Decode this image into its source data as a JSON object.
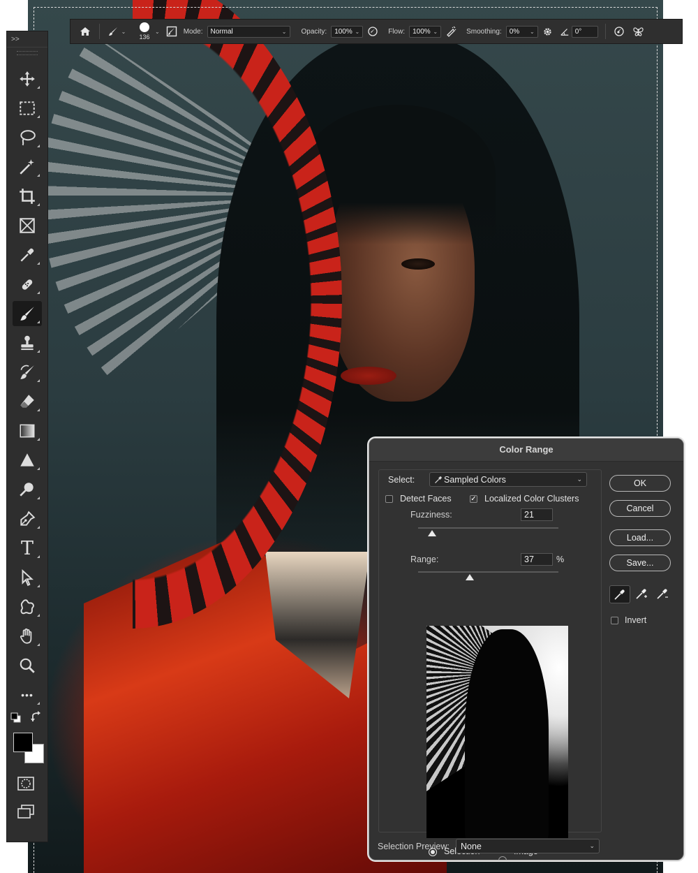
{
  "options_bar": {
    "brush_size": "136",
    "mode_label": "Mode:",
    "mode_value": "Normal",
    "opacity_label": "Opacity:",
    "opacity_value": "100%",
    "flow_label": "Flow:",
    "flow_value": "100%",
    "smoothing_label": "Smoothing:",
    "smoothing_value": "0%",
    "angle_value": "0°"
  },
  "toolbar": {
    "collapse_glyph": ">>",
    "tools": [
      {
        "name": "move-tool",
        "icon": "move-icon"
      },
      {
        "name": "rectangular-marquee-tool",
        "icon": "marquee-icon"
      },
      {
        "name": "lasso-tool",
        "icon": "lasso-icon"
      },
      {
        "name": "magic-wand-tool",
        "icon": "magic-wand-icon"
      },
      {
        "name": "crop-tool",
        "icon": "crop-icon"
      },
      {
        "name": "frame-tool",
        "icon": "frame-icon"
      },
      {
        "name": "eyedropper-tool",
        "icon": "eyedropper-icon"
      },
      {
        "name": "spot-healing-tool",
        "icon": "healing-icon"
      },
      {
        "name": "brush-tool",
        "icon": "brush-icon",
        "active": true
      },
      {
        "name": "clone-stamp-tool",
        "icon": "stamp-icon"
      },
      {
        "name": "history-brush-tool",
        "icon": "history-brush-icon"
      },
      {
        "name": "eraser-tool",
        "icon": "eraser-icon"
      },
      {
        "name": "gradient-tool",
        "icon": "gradient-icon"
      },
      {
        "name": "blur-tool",
        "icon": "blur-icon"
      },
      {
        "name": "dodge-tool",
        "icon": "dodge-icon"
      },
      {
        "name": "pen-tool",
        "icon": "pen-icon"
      },
      {
        "name": "type-tool",
        "icon": "type-icon"
      },
      {
        "name": "path-selection-tool",
        "icon": "path-selection-icon"
      },
      {
        "name": "custom-shape-tool",
        "icon": "shape-icon"
      },
      {
        "name": "hand-tool",
        "icon": "hand-icon"
      },
      {
        "name": "zoom-tool",
        "icon": "zoom-icon"
      },
      {
        "name": "more-tools",
        "icon": "more-icon"
      }
    ],
    "type_glyph": "T",
    "more_glyph": "•••",
    "foreground_color": "#000000",
    "background_color": "#ffffff"
  },
  "dialog": {
    "title": "Color Range",
    "select_label": "Select:",
    "select_value": "Sampled Colors",
    "detect_faces_label": "Detect Faces",
    "detect_faces_checked": false,
    "localized_label": "Localized Color Clusters",
    "localized_checked": true,
    "fuzziness_label": "Fuzziness:",
    "fuzziness_value": "21",
    "fuzziness_level": 0.1,
    "range_label": "Range:",
    "range_value": "37",
    "range_unit": "%",
    "range_level": 0.37,
    "selection_label": "Selection",
    "image_label": "Image",
    "selected_view": "Selection",
    "preview_label": "Selection Preview:",
    "preview_value": "None",
    "ok_label": "OK",
    "cancel_label": "Cancel",
    "load_label": "Load...",
    "save_label": "Save...",
    "invert_label": "Invert",
    "invert_checked": false,
    "checkmark": "✓"
  }
}
